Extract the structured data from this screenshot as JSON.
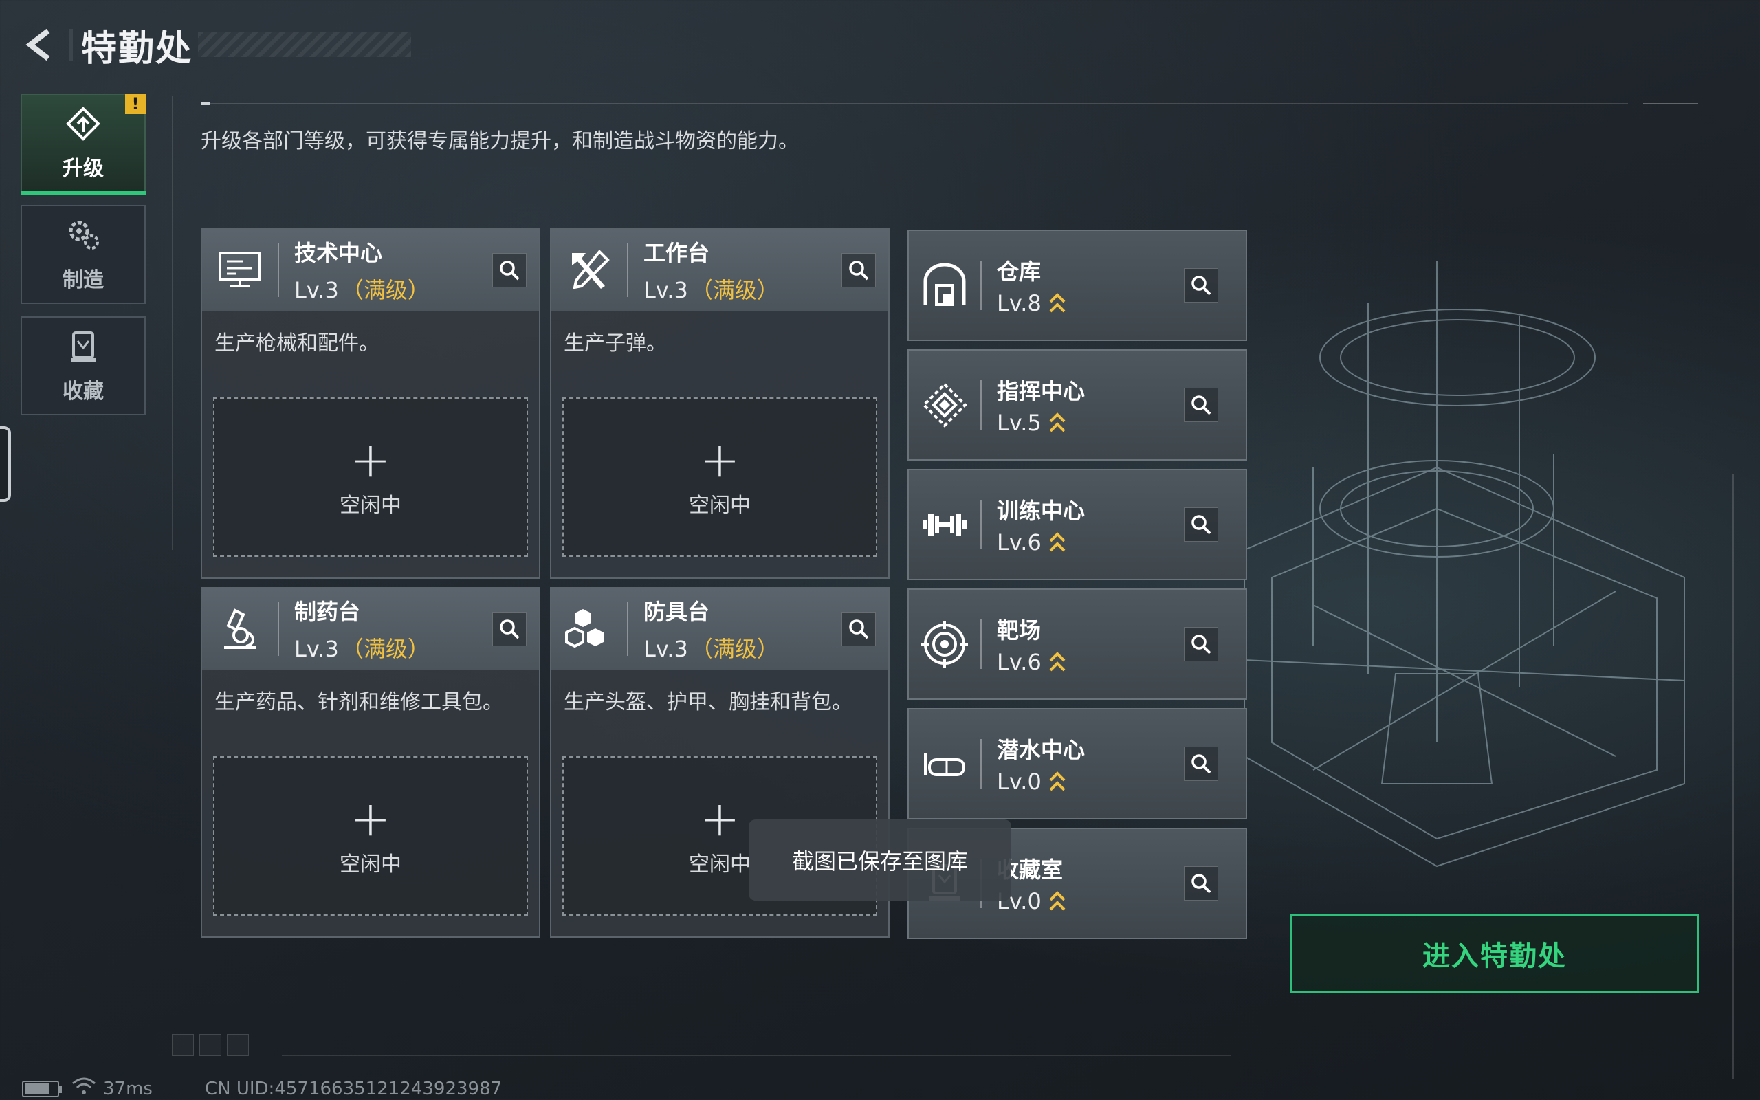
{
  "header": {
    "title": "特勤处"
  },
  "tabs": [
    {
      "id": "upgrade",
      "label": "升级",
      "icon": "upgrade-icon",
      "active": true,
      "alert": "!"
    },
    {
      "id": "craft",
      "label": "制造",
      "icon": "gears-icon",
      "active": false
    },
    {
      "id": "collection",
      "label": "收藏",
      "icon": "collection-icon",
      "active": false
    }
  ],
  "description": "升级各部门等级，可获得专属能力提升，和制造战斗物资的能力。",
  "facilities": [
    {
      "name": "技术中心",
      "level": "Lv.3",
      "max_label": "（满级）",
      "icon": "monitor-icon",
      "desc": "生产枪械和配件。",
      "slot_plus": "+",
      "slot_label": "空闲中"
    },
    {
      "name": "工作台",
      "level": "Lv.3",
      "max_label": "（满级）",
      "icon": "tools-icon",
      "desc": "生产子弹。",
      "slot_plus": "+",
      "slot_label": "空闲中"
    },
    {
      "name": "制药台",
      "level": "Lv.3",
      "max_label": "（满级）",
      "icon": "microscope-icon",
      "desc": "生产药品、针剂和维修工具包。",
      "slot_plus": "+",
      "slot_label": "空闲中"
    },
    {
      "name": "防具台",
      "level": "Lv.3",
      "max_label": "（满级）",
      "icon": "cubes-icon",
      "desc": "生产头盔、护甲、胸挂和背包。",
      "slot_plus": "+",
      "slot_label": "空闲中"
    }
  ],
  "departments": [
    {
      "name": "仓库",
      "level": "Lv.8",
      "icon": "warehouse-icon"
    },
    {
      "name": "指挥中心",
      "level": "Lv.5",
      "icon": "command-icon"
    },
    {
      "name": "训练中心",
      "level": "Lv.6",
      "icon": "dumbbell-icon"
    },
    {
      "name": "靶场",
      "level": "Lv.6",
      "icon": "target-icon"
    },
    {
      "name": "潜水中心",
      "level": "Lv.0",
      "icon": "diving-mask-icon"
    },
    {
      "name": "收藏室",
      "level": "Lv.0",
      "icon": "collection-icon"
    }
  ],
  "enter_button": "进入特勤处",
  "toast": "截图已保存至图库",
  "status": {
    "ping": "37ms",
    "uid": "CN UID:45716635121243923987"
  },
  "colors": {
    "accent_green": "#2fc77a",
    "max_gold": "#f1c141",
    "alert_yellow": "#e8b427"
  }
}
